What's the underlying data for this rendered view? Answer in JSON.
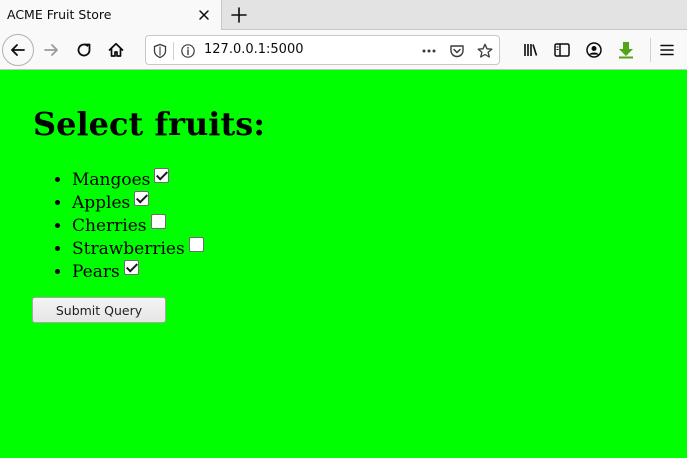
{
  "browser": {
    "tab_title": "ACME Fruit Store",
    "url": "127.0.0.1:5000"
  },
  "page": {
    "heading": "Select fruits:",
    "fruits": [
      {
        "label": "Mangoes",
        "checked": true
      },
      {
        "label": "Apples",
        "checked": true
      },
      {
        "label": "Cherries",
        "checked": false
      },
      {
        "label": "Strawberries",
        "checked": false
      },
      {
        "label": "Pears",
        "checked": true
      }
    ],
    "submit_label": "Submit Query"
  },
  "colors": {
    "page_background": "#00ff00"
  },
  "icons": {
    "tab_close": "close-icon",
    "new_tab": "plus-icon",
    "back": "arrow-left-icon",
    "forward": "arrow-right-icon",
    "reload": "reload-icon",
    "home": "home-icon",
    "shield": "shield-icon",
    "info": "info-icon",
    "page_actions": "more-horizontal-icon",
    "pocket": "pocket-icon",
    "bookmark": "star-icon",
    "library": "library-icon",
    "sidebar": "sidebar-icon",
    "account": "account-icon",
    "download": "download-icon",
    "menu": "hamburger-menu-icon"
  }
}
